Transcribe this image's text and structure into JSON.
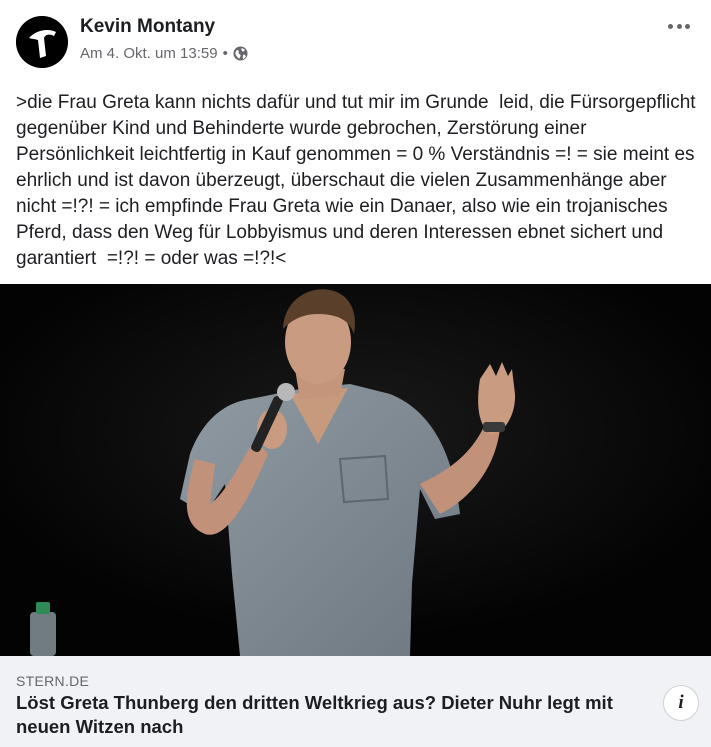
{
  "post": {
    "author": "Kevin Montany",
    "timestamp": "Am 4. Okt. um 13:59",
    "separator": "•",
    "privacy_icon": "globe-icon",
    "more_icon": "more-horizontal-icon",
    "text": ">die Frau Greta kann nichts dafür und tut mir im Grunde  leid, die Fürsorgepflicht gegenüber Kind und Behinderte wurde gebrochen, Zerstörung einer Persönlichkeit leichtfertig in Kauf genommen = 0 % Verständnis =! = sie meint es ehrlich und ist davon überzeugt, überschaut die vielen Zusammenhänge aber nicht =!?! = ich empfinde Frau Greta wie ein Danaer, also wie ein trojanisches Pferd, dass den Weg für Lobbyismus und deren Interessen ebnet sichert und garantiert  =!?! = oder was =!?!<"
  },
  "link_preview": {
    "source": "STERN.DE",
    "headline": "Löst Greta Thunberg den dritten Weltkrieg aus? Dieter Nuhr legt mit neuen Witzen nach",
    "info_label": "i"
  },
  "colors": {
    "text": "#1c1e21",
    "secondary": "#65676b",
    "card_bg": "#f0f2f5",
    "photo_bg": "#050505"
  }
}
